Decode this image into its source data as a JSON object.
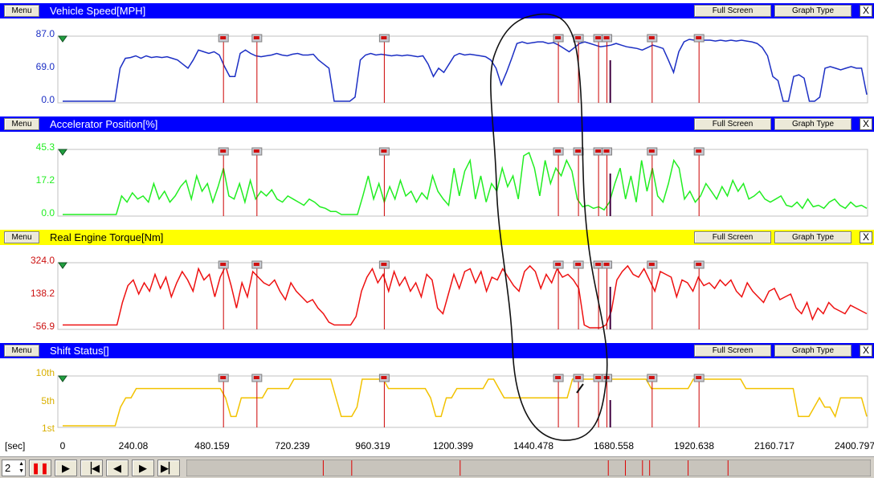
{
  "buttons": {
    "menu": "Menu",
    "full_screen": "Full Screen",
    "graph_type": "Graph Type",
    "close": "X"
  },
  "panels": [
    {
      "id": "speed",
      "title": "Vehicle Speed[MPH]",
      "header_color": "#0000ff",
      "title_color": "#ffffff",
      "line_color": "#1c2fc4",
      "label_color": "#1c2fc4",
      "y_labels": [
        "87.0",
        "69.0",
        "0.0"
      ],
      "series": [
        0,
        0,
        0,
        0,
        0,
        0,
        0,
        0,
        0,
        0,
        0,
        40,
        52,
        53,
        55,
        52,
        55,
        53,
        54,
        53,
        54,
        52,
        50,
        45,
        40,
        50,
        62,
        60,
        58,
        60,
        56,
        42,
        30,
        30,
        58,
        62,
        58,
        55,
        54,
        55,
        56,
        58,
        56,
        55,
        57,
        58,
        56,
        56,
        57,
        50,
        45,
        40,
        0,
        0,
        0,
        0,
        5,
        50,
        56,
        58,
        56,
        57,
        56,
        55,
        56,
        55,
        56,
        55,
        54,
        55,
        45,
        30,
        40,
        35,
        45,
        55,
        58,
        56,
        57,
        56,
        55,
        54,
        50,
        40,
        20,
        35,
        52,
        70,
        72,
        70,
        71,
        72,
        72,
        70,
        71,
        68,
        64,
        60,
        65,
        70,
        72,
        70,
        68,
        66,
        67,
        68,
        70,
        68,
        66,
        65,
        64,
        62,
        65,
        68,
        66,
        64,
        50,
        35,
        60,
        72,
        75,
        74,
        73,
        74,
        74,
        73,
        74,
        73,
        74,
        73,
        74,
        73,
        72,
        70,
        65,
        55,
        30,
        25,
        0,
        0,
        30,
        32,
        28,
        0,
        0,
        5,
        40,
        42,
        40,
        38,
        40,
        42,
        40,
        40,
        8
      ],
      "stats": [
        "min",
        "max"
      ]
    },
    {
      "id": "accel",
      "title": "Accelerator Position[%]",
      "header_color": "#0000ff",
      "title_color": "#ffffff",
      "line_color": "#22ee22",
      "label_color": "#22ee22",
      "y_labels": [
        "45.3",
        "17.2",
        "0.0"
      ],
      "series": [
        0,
        0,
        0,
        0,
        0,
        0,
        0,
        0,
        0,
        0,
        0,
        12,
        8,
        14,
        10,
        12,
        8,
        20,
        10,
        15,
        8,
        12,
        18,
        22,
        10,
        25,
        15,
        20,
        8,
        18,
        30,
        12,
        10,
        20,
        8,
        22,
        10,
        15,
        12,
        16,
        10,
        8,
        12,
        10,
        8,
        6,
        10,
        8,
        5,
        4,
        2,
        2,
        0,
        0,
        0,
        0,
        12,
        25,
        10,
        20,
        8,
        18,
        10,
        22,
        12,
        15,
        8,
        14,
        10,
        25,
        15,
        10,
        6,
        30,
        12,
        28,
        35,
        10,
        25,
        8,
        20,
        15,
        30,
        18,
        25,
        10,
        38,
        40,
        30,
        12,
        35,
        20,
        30,
        25,
        35,
        28,
        10,
        5,
        6,
        4,
        5,
        3,
        8,
        20,
        30,
        10,
        25,
        8,
        35,
        15,
        30,
        12,
        8,
        20,
        35,
        30,
        10,
        15,
        8,
        12,
        20,
        15,
        10,
        18,
        12,
        22,
        15,
        20,
        10,
        12,
        15,
        10,
        8,
        10,
        12,
        6,
        5,
        8,
        4,
        10,
        5,
        6,
        4,
        8,
        10,
        6,
        4,
        8,
        5,
        6,
        4
      ],
      "stats": [
        "min",
        "max"
      ]
    },
    {
      "id": "torque",
      "title": "Real Engine Torque[Nm]",
      "header_color": "#ffff00",
      "title_color": "#000000",
      "line_color": "#ee1111",
      "label_color": "#cc1111",
      "y_labels": [
        "324.0",
        "138.2",
        "-56.9"
      ],
      "series": [
        0,
        0,
        0,
        0,
        0,
        0,
        0,
        0,
        0,
        0,
        0,
        80,
        140,
        160,
        110,
        150,
        120,
        180,
        130,
        170,
        100,
        150,
        190,
        160,
        120,
        200,
        160,
        180,
        100,
        170,
        210,
        140,
        60,
        150,
        100,
        190,
        170,
        150,
        140,
        160,
        120,
        90,
        150,
        120,
        100,
        80,
        90,
        60,
        40,
        10,
        0,
        0,
        0,
        0,
        30,
        120,
        170,
        200,
        150,
        180,
        120,
        190,
        140,
        170,
        120,
        150,
        100,
        180,
        160,
        60,
        40,
        110,
        180,
        130,
        190,
        200,
        150,
        190,
        120,
        170,
        160,
        200,
        170,
        140,
        120,
        190,
        210,
        190,
        130,
        180,
        150,
        200,
        170,
        180,
        160,
        130,
        0,
        -10,
        -10,
        -10,
        0,
        50,
        160,
        190,
        210,
        180,
        170,
        200,
        160,
        120,
        190,
        180,
        170,
        100,
        160,
        150,
        120,
        170,
        140,
        150,
        130,
        160,
        140,
        160,
        120,
        100,
        150,
        120,
        100,
        80,
        120,
        130,
        90,
        100,
        110,
        60,
        40,
        80,
        20,
        60,
        40,
        80,
        60,
        50,
        40,
        70,
        60,
        50,
        40
      ],
      "stats": [
        "min",
        "max"
      ]
    },
    {
      "id": "shift",
      "title": "Shift Status[]",
      "header_color": "#0000ff",
      "title_color": "#ffffff",
      "line_color": "#f2c200",
      "label_color": "#d9b000",
      "y_labels": [
        "10th",
        "5th",
        "1st"
      ],
      "series": [
        1,
        1,
        1,
        1,
        1,
        1,
        1,
        1,
        1,
        1,
        1,
        3,
        4,
        4,
        5,
        5,
        5,
        5,
        5,
        5,
        5,
        5,
        5,
        5,
        5,
        5,
        5,
        5,
        5,
        5,
        5,
        4,
        2,
        2,
        4,
        4,
        4,
        4,
        4,
        5,
        5,
        5,
        5,
        5,
        6,
        6,
        6,
        6,
        6,
        6,
        6,
        6,
        4,
        2,
        2,
        2,
        3,
        6,
        6,
        6,
        6,
        6,
        5,
        5,
        5,
        5,
        5,
        5,
        5,
        5,
        4,
        2,
        2,
        4,
        4,
        5,
        5,
        5,
        5,
        5,
        5,
        6,
        6,
        5,
        4,
        4,
        4,
        4,
        4,
        4,
        4,
        4,
        4,
        4,
        4,
        4,
        4,
        6,
        6,
        6,
        6,
        6,
        6,
        6,
        6,
        6,
        6,
        6,
        6,
        6,
        6,
        6,
        5,
        5,
        5,
        5,
        5,
        5,
        5,
        5,
        6,
        6,
        6,
        6,
        6,
        6,
        6,
        6,
        6,
        6,
        5,
        5,
        5,
        5,
        5,
        5,
        5,
        5,
        5,
        5,
        2,
        2,
        2,
        3,
        4,
        3,
        3,
        2,
        4,
        4,
        4,
        4,
        4,
        2
      ],
      "stats": [
        "min",
        "max"
      ]
    }
  ],
  "marker_times": [
    480.159,
    580,
    960.319,
    1480,
    1540,
    1600,
    1625,
    1760,
    1900
  ],
  "playhead_time": 1635,
  "x_axis": {
    "unit": "[sec]",
    "ticks": [
      "0",
      "240.08",
      "480.159",
      "720.239",
      "960.319",
      "1200.399",
      "1440.478",
      "1680.558",
      "1920.638",
      "2160.717",
      "2400.797"
    ],
    "max": 2400.797
  },
  "playback": {
    "speed_value": "2",
    "pause_color": "#ee0000"
  }
}
